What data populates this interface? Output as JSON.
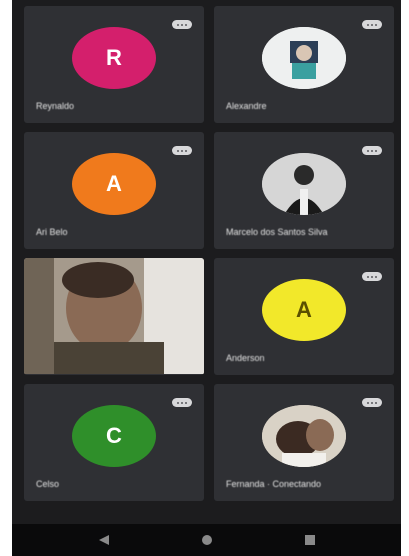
{
  "participants": [
    {
      "name": "Reynaldo",
      "initial": "R",
      "avatar_color": "#d41f6c",
      "type": "initial"
    },
    {
      "name": "Alexandre",
      "initial": "",
      "avatar_color": "#e8e8e8",
      "type": "photo"
    },
    {
      "name": "Ari Belo",
      "initial": "A",
      "avatar_color": "#f07a1c",
      "type": "initial"
    },
    {
      "name": "Marcelo dos Santos Silva",
      "initial": "",
      "avatar_color": "#9a9a9a",
      "type": "photo"
    },
    {
      "name": "",
      "initial": "",
      "avatar_color": "",
      "type": "video"
    },
    {
      "name": "Anderson",
      "initial": "A",
      "avatar_color": "#f2e82a",
      "type": "initial"
    },
    {
      "name": "Celso",
      "initial": "C",
      "avatar_color": "#2f8f2a",
      "type": "initial"
    },
    {
      "name": "Fernanda · Conectando",
      "initial": "",
      "avatar_color": "#cfc6b8",
      "type": "photo"
    }
  ],
  "navigation": {
    "icons": [
      "back-icon",
      "home-icon",
      "recents-icon"
    ]
  }
}
